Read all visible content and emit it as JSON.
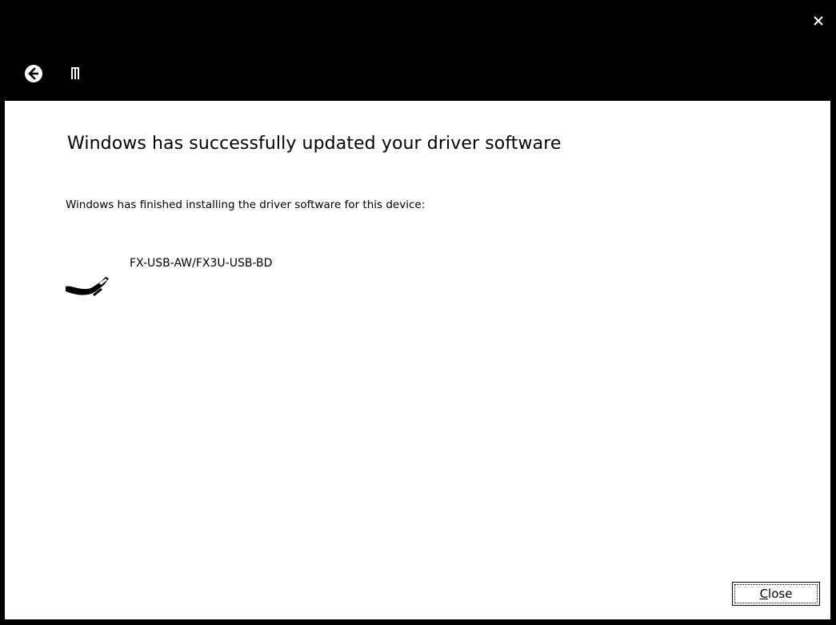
{
  "titlebar": {
    "close_icon": "close-x-icon",
    "back_icon": "back-arrow-icon",
    "app_icon": "driver-setup-icon"
  },
  "main": {
    "heading": "Windows has successfully updated your driver software",
    "subtext": "Windows has finished installing the driver software for this device:",
    "device": {
      "icon": "usb-cable-icon",
      "name": "FX-USB-AW/FX3U-USB-BD"
    }
  },
  "footer": {
    "close_button_accel": "C",
    "close_button_rest": "lose"
  },
  "colors": {
    "titlebar_bg": "#000000",
    "content_bg": "#ffffff",
    "text": "#000000"
  }
}
